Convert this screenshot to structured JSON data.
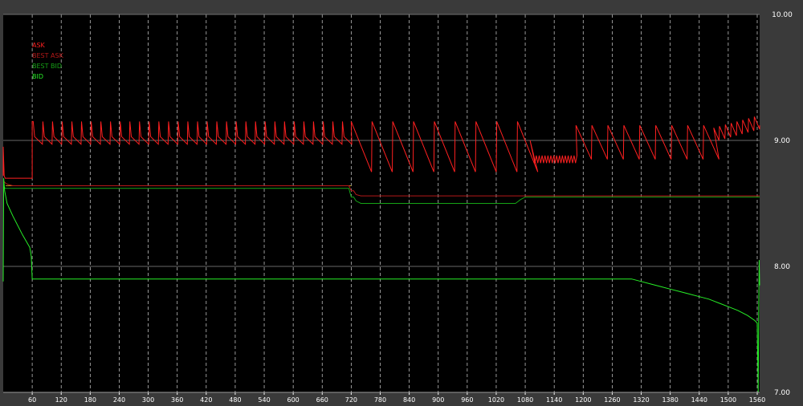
{
  "chart_data": {
    "type": "line",
    "xlim": [
      0,
      1565
    ],
    "ylim": [
      7.0,
      10.0
    ],
    "x_ticks": [
      60,
      120,
      180,
      240,
      300,
      360,
      420,
      480,
      540,
      600,
      660,
      720,
      780,
      840,
      900,
      960,
      1020,
      1080,
      1140,
      1200,
      1260,
      1320,
      1380,
      1440,
      1500,
      1560
    ],
    "x_tick_labels": [
      "60",
      "120",
      "180",
      "240",
      "300",
      "360",
      "420",
      "480",
      "540",
      "600",
      "660",
      "720",
      "780",
      "840",
      "900",
      "960",
      "1020",
      "1080",
      "1140",
      "1200",
      "1260",
      "1320",
      "1380",
      "1440",
      "1500",
      "1560"
    ],
    "y_ticks": [
      10.0,
      9.0,
      8.0,
      7.0
    ],
    "y_tick_labels": [
      "10.00",
      "9.00",
      "8.00",
      "7.00"
    ],
    "grid": true,
    "legend_position": "top-left",
    "colors": {
      "background": "#3a3a3a",
      "plot_background": "#000000",
      "grid": "#bcbcbc",
      "ask": "#ff2020",
      "best_ask": "#b51818",
      "best_bid": "#16a316",
      "bid": "#27ef27",
      "best_bid_early": "#c4a020"
    },
    "series": [
      {
        "name": "ASK",
        "color": "#ff2020",
        "x": [
          0,
          0,
          2,
          4,
          4,
          20,
          25,
          38,
          55,
          60,
          60,
          62,
          62,
          118,
          118,
          140,
          140,
          280,
          280,
          300,
          300,
          720,
          720,
          830,
          830,
          1090,
          1090,
          1130,
          1130,
          1185,
          1185,
          1260,
          1260,
          1470,
          1470,
          1565
        ],
        "y": [
          8.72,
          8.95,
          8.72,
          8.7,
          8.7,
          8.7,
          8.7,
          8.7,
          8.7,
          8.7,
          9.15,
          9.05,
          9.1,
          9.0,
          9.1,
          9.02,
          9.1,
          8.98,
          9.1,
          9.0,
          9.08,
          8.98,
          9.1,
          8.85,
          9.1,
          8.82,
          9.0,
          8.85,
          9.0,
          8.88,
          9.1,
          8.88,
          9.08,
          8.96,
          9.1,
          9.08
        ]
      },
      {
        "name": "BEST ASK",
        "color": "#b51818",
        "x": [
          0,
          5,
          10,
          20,
          60,
          200,
          400,
          700,
          715,
          720,
          725,
          730,
          740,
          780,
          900,
          1050,
          1080,
          1200,
          1400,
          1565
        ],
        "y": [
          8.68,
          8.66,
          8.65,
          8.64,
          8.64,
          8.64,
          8.64,
          8.64,
          8.64,
          8.6,
          8.6,
          8.57,
          8.56,
          8.56,
          8.56,
          8.56,
          8.56,
          8.56,
          8.56,
          8.56
        ]
      },
      {
        "name": "BEST BID",
        "color": "#16a316",
        "x": [
          0,
          5,
          10,
          20,
          60,
          200,
          400,
          700,
          715,
          720,
          725,
          730,
          740,
          780,
          900,
          1060,
          1070,
          1080,
          1200,
          1400,
          1565
        ],
        "y": [
          8.63,
          8.62,
          8.62,
          8.62,
          8.62,
          8.62,
          8.62,
          8.62,
          8.62,
          8.55,
          8.55,
          8.52,
          8.5,
          8.5,
          8.5,
          8.5,
          8.53,
          8.55,
          8.55,
          8.55,
          8.55
        ]
      },
      {
        "name": "BID",
        "color": "#27ef27",
        "x": [
          0,
          1,
          3,
          8,
          20,
          40,
          55,
          58,
          60,
          200,
          400,
          600,
          800,
          1000,
          1200,
          1300,
          1320,
          1340,
          1360,
          1380,
          1400,
          1420,
          1440,
          1460,
          1480,
          1500,
          1520,
          1540,
          1555,
          1560,
          1562,
          1563,
          1564,
          1565
        ],
        "y": [
          7.88,
          8.7,
          8.6,
          8.5,
          8.4,
          8.25,
          8.15,
          8.08,
          7.9,
          7.9,
          7.9,
          7.9,
          7.9,
          7.9,
          7.9,
          7.9,
          7.88,
          7.86,
          7.84,
          7.82,
          7.8,
          7.78,
          7.76,
          7.74,
          7.71,
          7.68,
          7.65,
          7.61,
          7.57,
          7.55,
          7.0,
          7.6,
          8.05,
          7.85
        ]
      }
    ]
  }
}
